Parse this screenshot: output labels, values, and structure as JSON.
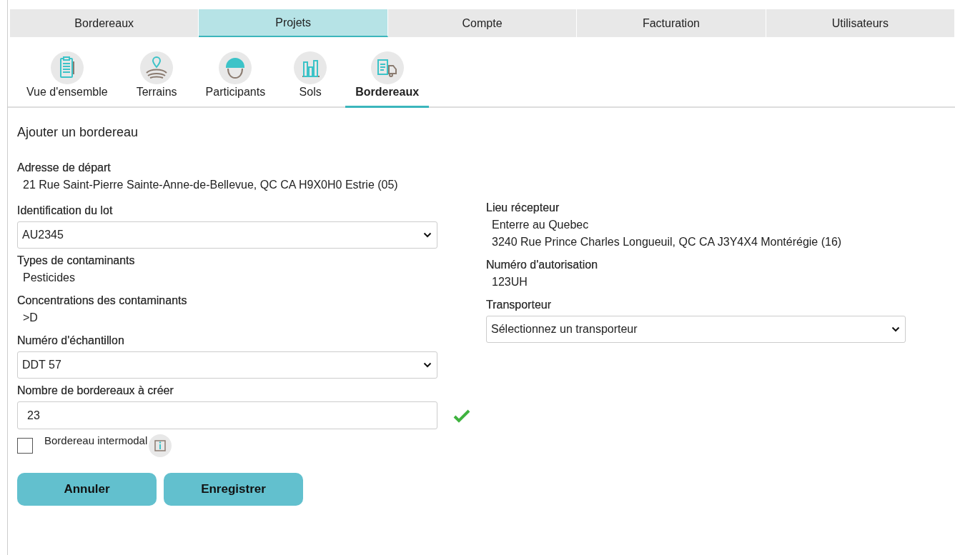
{
  "main_tabs": [
    {
      "label": "Bordereaux",
      "selected": false
    },
    {
      "label": "Projets",
      "selected": true
    },
    {
      "label": "Compte",
      "selected": false
    },
    {
      "label": "Facturation",
      "selected": false
    },
    {
      "label": "Utilisateurs",
      "selected": false
    }
  ],
  "sub_tabs": [
    {
      "label": "Vue d'ensemble",
      "kind": "clipboard",
      "selected": false
    },
    {
      "label": "Terrains",
      "kind": "pin",
      "selected": false
    },
    {
      "label": "Participants",
      "kind": "helmet",
      "selected": false
    },
    {
      "label": "Sols",
      "kind": "bars",
      "selected": false
    },
    {
      "label": "Bordereaux",
      "kind": "truck",
      "selected": true
    }
  ],
  "form": {
    "title": "Ajouter un bordereau",
    "departure": {
      "label": "Adresse de départ",
      "value": "21 Rue Saint-Pierre Sainte-Anne-de-Bellevue, QC CA H9X0H0 Estrie (05)"
    },
    "left": [
      {
        "kind": "select",
        "label": "Identification du lot",
        "value": "AU2345"
      },
      {
        "kind": "text",
        "label": "Types de contaminants",
        "value": "Pesticides"
      },
      {
        "kind": "text",
        "label": "Concentrations des contaminants",
        "value": ">D"
      },
      {
        "kind": "select",
        "label": "Numéro d'échantillon",
        "value": "DDT 57"
      },
      {
        "kind": "number",
        "label": "Nombre de bordereaux à créer",
        "value": "23",
        "valid": true
      }
    ],
    "intermodal": {
      "label": "Bordereau intermodal",
      "checked": false
    },
    "right": [
      {
        "kind": "text",
        "label": "Lieu récepteur",
        "value": "Enterre au Quebec",
        "value2": "3240 Rue Prince Charles Longueuil, QC CA J3Y4X4 Montérégie (16)"
      },
      {
        "kind": "text",
        "label": "Numéro d'autorisation",
        "value": "123UH"
      },
      {
        "kind": "select",
        "label": "Transporteur",
        "value": "Sélectionnez un transporteur"
      }
    ],
    "buttons": [
      "Annuler",
      "Enregistrer"
    ]
  }
}
